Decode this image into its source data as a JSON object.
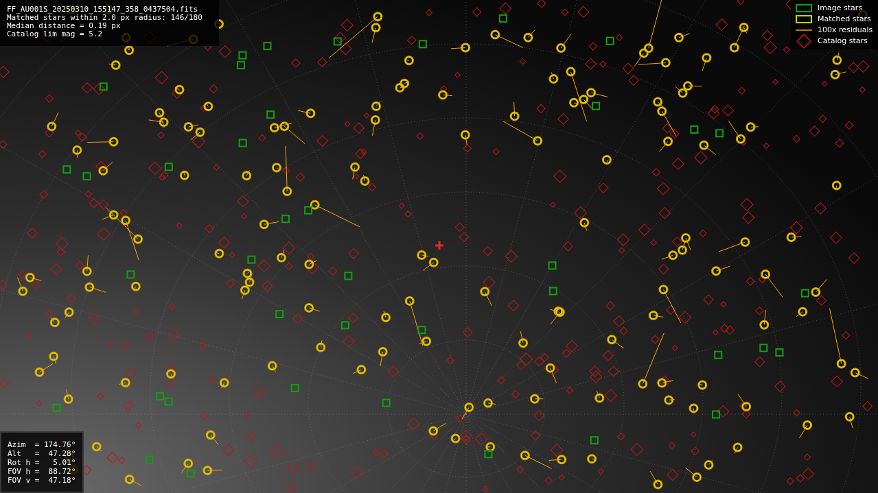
{
  "info_lines": [
    "FF_AU001S_20250310_155147_358_0437504.fits",
    "Matched stars within 2.0 px radius: 146/180",
    "Median distance = 0.19 px",
    "Catalog lim mag = 5.2"
  ],
  "legend": [
    {
      "kind": "image",
      "label": "Image stars"
    },
    {
      "kind": "matched",
      "label": "Matched stars"
    },
    {
      "kind": "residual",
      "label": "100x residuals"
    },
    {
      "kind": "catalog",
      "label": "Catalog stars"
    }
  ],
  "pointing_lines": [
    "Azim  = 174.76°",
    "Alt   =  47.28°",
    "Rot h =   5.01°",
    "FOV h =  88.72°",
    "FOV v =  47.18°"
  ]
}
